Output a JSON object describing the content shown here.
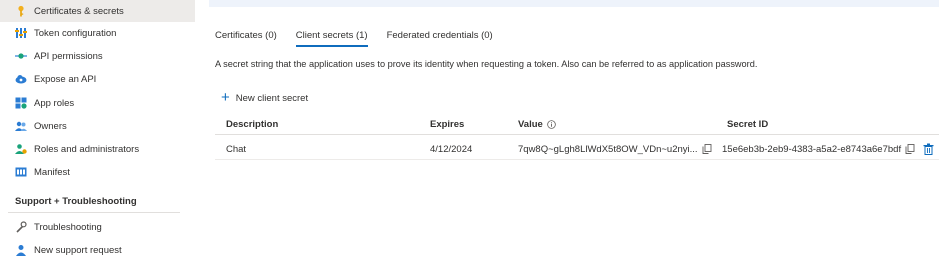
{
  "sidebar": {
    "items": [
      {
        "label": "Certificates & secrets",
        "icon": "key-icon",
        "selected": true
      },
      {
        "label": "Token configuration",
        "icon": "token-config-icon"
      },
      {
        "label": "API permissions",
        "icon": "api-permissions-icon"
      },
      {
        "label": "Expose an API",
        "icon": "cloud-api-icon"
      },
      {
        "label": "App roles",
        "icon": "app-roles-icon"
      },
      {
        "label": "Owners",
        "icon": "owners-icon"
      },
      {
        "label": "Roles and administrators",
        "icon": "roles-admins-icon"
      },
      {
        "label": "Manifest",
        "icon": "manifest-icon"
      }
    ],
    "support_header": "Support + Troubleshooting",
    "support_items": [
      {
        "label": "Troubleshooting",
        "icon": "wrench-icon"
      },
      {
        "label": "New support request",
        "icon": "support-person-icon"
      }
    ]
  },
  "tabs": [
    {
      "label": "Certificates (0)",
      "active": false
    },
    {
      "label": "Client secrets (1)",
      "active": true
    },
    {
      "label": "Federated credentials (0)",
      "active": false
    }
  ],
  "description": "A secret string that the application uses to prove its identity when requesting a token. Also can be referred to as application password.",
  "add_button": {
    "label": "New client secret",
    "icon": "plus-icon"
  },
  "table": {
    "headers": {
      "description": "Description",
      "expires": "Expires",
      "value": "Value",
      "secret_id": "Secret ID"
    },
    "rows": [
      {
        "description": "Chat",
        "expires": "4/12/2024",
        "value": "7qw8Q~gLgh8LlWdX5t8OW_VDn~u2nyi...",
        "secret_id": "15e6eb3b-2eb9-4383-a5a2-e8743a6e7bdf"
      }
    ]
  },
  "colors": {
    "accent": "#0f6cbd",
    "selected_bg": "#edebe9",
    "topbar_bg": "#eef3fb"
  }
}
